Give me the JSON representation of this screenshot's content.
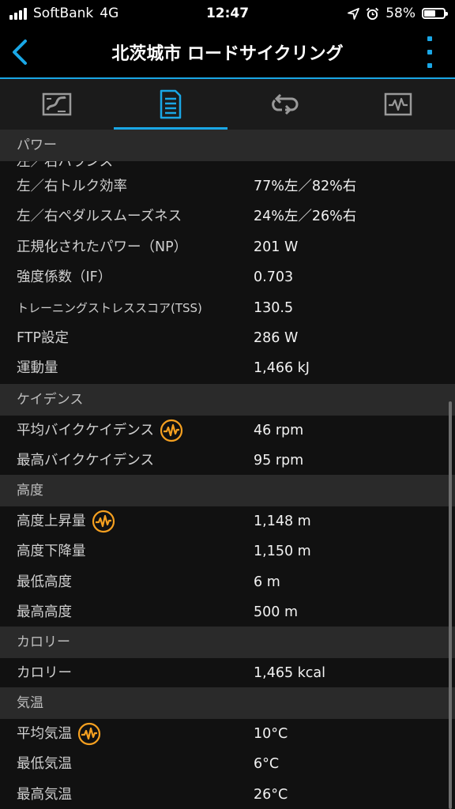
{
  "status_bar": {
    "carrier": "SoftBank",
    "network": "4G",
    "time": "12:47",
    "battery": "58%",
    "battery_level": 0.58,
    "icons": [
      "location-arrow-icon",
      "alarm-clock-icon"
    ]
  },
  "nav": {
    "title": "北茨城市 ロードサイクリング",
    "back_icon": "chevron-left-icon",
    "menu_icon": "more-vertical-icon"
  },
  "tabs": [
    {
      "icon": "map-icon",
      "active": false
    },
    {
      "icon": "details-document-icon",
      "active": true
    },
    {
      "icon": "laps-loop-icon",
      "active": false
    },
    {
      "icon": "chart-icon",
      "active": false
    }
  ],
  "sections": {
    "power": {
      "header": "パワー",
      "rows": [
        {
          "label": "左／右トルク効率",
          "value": "77%左／82%右"
        },
        {
          "label": "左／右ペダルスムーズネス",
          "value": "24%左／26%右"
        },
        {
          "label": "正規化されたパワー（NP）",
          "value": "201 W"
        },
        {
          "label": "強度係数（IF）",
          "value": "0.703"
        },
        {
          "label": "トレーニングストレススコア(TSS)",
          "value": "130.5"
        },
        {
          "label": "FTP設定",
          "value": "286 W"
        },
        {
          "label": "運動量",
          "value": "1,466 kJ"
        }
      ]
    },
    "cadence": {
      "header": "ケイデンス",
      "rows": [
        {
          "label": "平均バイクケイデンス",
          "value": "46 rpm",
          "icon": "pulse-icon"
        },
        {
          "label": "最高バイクケイデンス",
          "value": "95 rpm"
        }
      ]
    },
    "elevation": {
      "header": "高度",
      "rows": [
        {
          "label": "高度上昇量",
          "value": "1,148 m",
          "icon": "pulse-icon"
        },
        {
          "label": "高度下降量",
          "value": "1,150 m"
        },
        {
          "label": "最低高度",
          "value": "6 m"
        },
        {
          "label": "最高高度",
          "value": "500 m"
        }
      ]
    },
    "calories": {
      "header": "カロリー",
      "rows": [
        {
          "label": "カロリー",
          "value": "1,465 kcal"
        }
      ]
    },
    "temperature": {
      "header": "気温",
      "rows": [
        {
          "label": "平均気温",
          "value": "10°C",
          "icon": "pulse-icon"
        },
        {
          "label": "最低気温",
          "value": "6°C"
        },
        {
          "label": "最高気温",
          "value": "26°C"
        }
      ]
    }
  },
  "colors": {
    "accent": "#1aa7e6",
    "pulse_icon": "#f5a020",
    "section_bg": "#2a2a2a",
    "bg": "#111111"
  }
}
